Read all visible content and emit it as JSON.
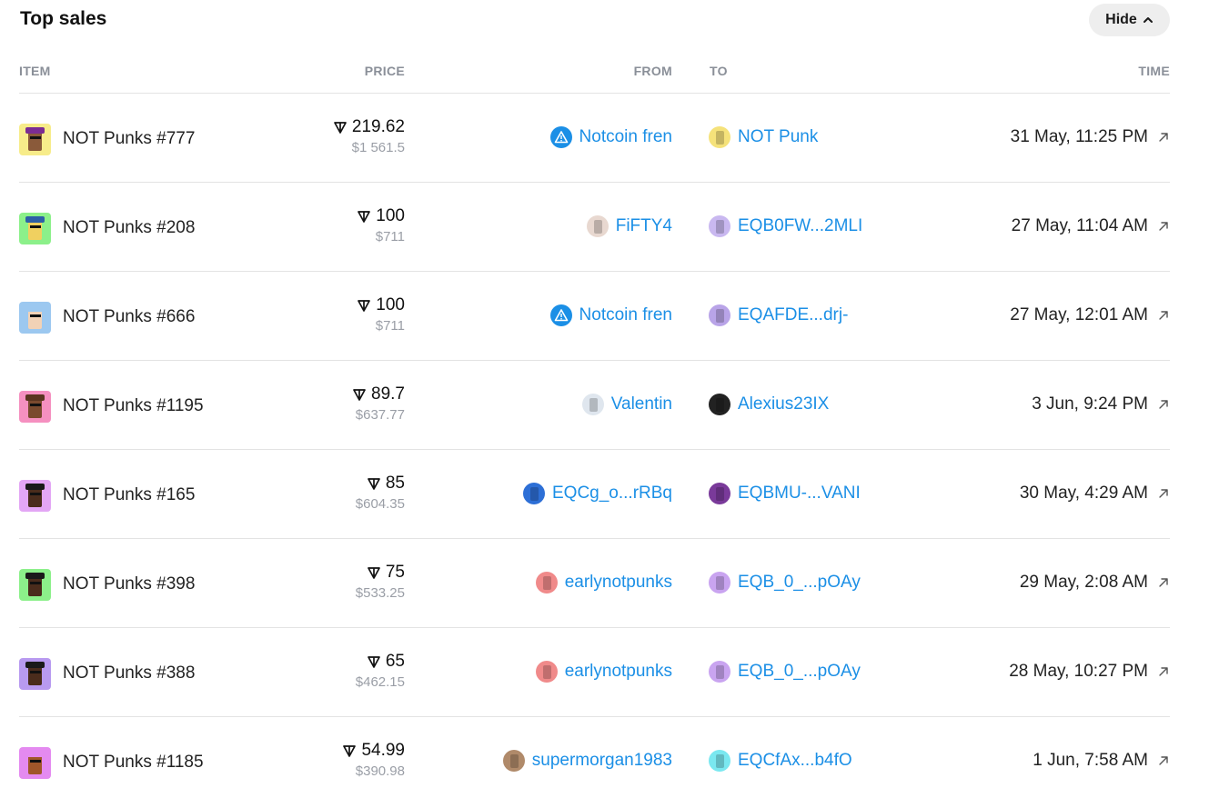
{
  "title": "Top sales",
  "hide_button": {
    "label": "Hide",
    "icon": "chevron-up-icon"
  },
  "columns": {
    "item": "ITEM",
    "price": "PRICE",
    "from": "FROM",
    "to": "TO",
    "time": "TIME"
  },
  "colors": {
    "link": "#1b8fe6",
    "muted": "#9a9ea6",
    "divider": "#e3e3e3"
  },
  "rows": [
    {
      "item": "NOT Punks #777",
      "ton": "219.62",
      "usd": "$1 561.5",
      "from": "Notcoin fren",
      "from_icon": "warning-icon",
      "to": "NOT Punk",
      "to_icon": "punk-avatar",
      "time": "31 May, 11:25 PM",
      "avatar_bg": "#f7ec8a",
      "skin": "#8a5a3a",
      "hat": "#7b2c93",
      "from_bg": "#1b8fe6",
      "to_bg": "#f5e27a"
    },
    {
      "item": "NOT Punks #208",
      "ton": "100",
      "usd": "$711",
      "from": "FiFTY4",
      "from_icon": "user-avatar",
      "to": "EQB0FW...2MLI",
      "to_icon": "user-avatar",
      "time": "27 May, 11:04 AM",
      "avatar_bg": "#8cf08a",
      "skin": "#f0d060",
      "hat": "#2d5fa6",
      "from_bg": "#e8d8d0",
      "to_bg": "#c9b8f0"
    },
    {
      "item": "NOT Punks #666",
      "ton": "100",
      "usd": "$711",
      "from": "Notcoin fren",
      "from_icon": "warning-icon",
      "to": "EQAFDE...drj-",
      "to_icon": "user-avatar",
      "time": "27 May, 12:01 AM",
      "avatar_bg": "#9cc8f0",
      "skin": "#f2d2b6",
      "hat": "#9cc8f0",
      "from_bg": "#1b8fe6",
      "to_bg": "#b9a4e8"
    },
    {
      "item": "NOT Punks #1195",
      "ton": "89.7",
      "usd": "$637.77",
      "from": "Valentin",
      "from_icon": "user-avatar",
      "to": "Alexius23IX",
      "to_icon": "user-avatar",
      "time": "3 Jun, 9:24 PM",
      "avatar_bg": "#f590c0",
      "skin": "#7a4a2e",
      "hat": "#5a3520",
      "from_bg": "#dfe6ee",
      "to_bg": "#222222"
    },
    {
      "item": "NOT Punks #165",
      "ton": "85",
      "usd": "$604.35",
      "from": "EQCg_o...rRBq",
      "from_icon": "user-avatar",
      "to": "EQBMU-...VANI",
      "to_icon": "user-avatar",
      "time": "30 May, 4:29 AM",
      "avatar_bg": "#e3a6f5",
      "skin": "#4a2c1c",
      "hat": "#1a1a1a",
      "from_bg": "#2d6fd6",
      "to_bg": "#7a3a9a"
    },
    {
      "item": "NOT Punks #398",
      "ton": "75",
      "usd": "$533.25",
      "from": "earlynotpunks",
      "from_icon": "user-avatar",
      "to": "EQB_0_...pOAy",
      "to_icon": "user-avatar",
      "time": "29 May, 2:08 AM",
      "avatar_bg": "#8cf08a",
      "skin": "#4a2c1c",
      "hat": "#1a1a1a",
      "from_bg": "#f08a8a",
      "to_bg": "#c9a4f0"
    },
    {
      "item": "NOT Punks #388",
      "ton": "65",
      "usd": "$462.15",
      "from": "earlynotpunks",
      "from_icon": "user-avatar",
      "to": "EQB_0_...pOAy",
      "to_icon": "user-avatar",
      "time": "28 May, 10:27 PM",
      "avatar_bg": "#b89af0",
      "skin": "#4a2c1c",
      "hat": "#1a1a1a",
      "from_bg": "#f08a8a",
      "to_bg": "#c9a4f0"
    },
    {
      "item": "NOT Punks #1185",
      "ton": "54.99",
      "usd": "$390.98",
      "from": "supermorgan1983",
      "from_icon": "user-avatar",
      "to": "EQCfAx...b4fO",
      "to_icon": "user-avatar",
      "time": "1 Jun, 7:58 AM",
      "avatar_bg": "#e48af0",
      "skin": "#a0562a",
      "hat": "#e48af0",
      "from_bg": "#b08a6a",
      "to_bg": "#7ae8f0"
    }
  ]
}
